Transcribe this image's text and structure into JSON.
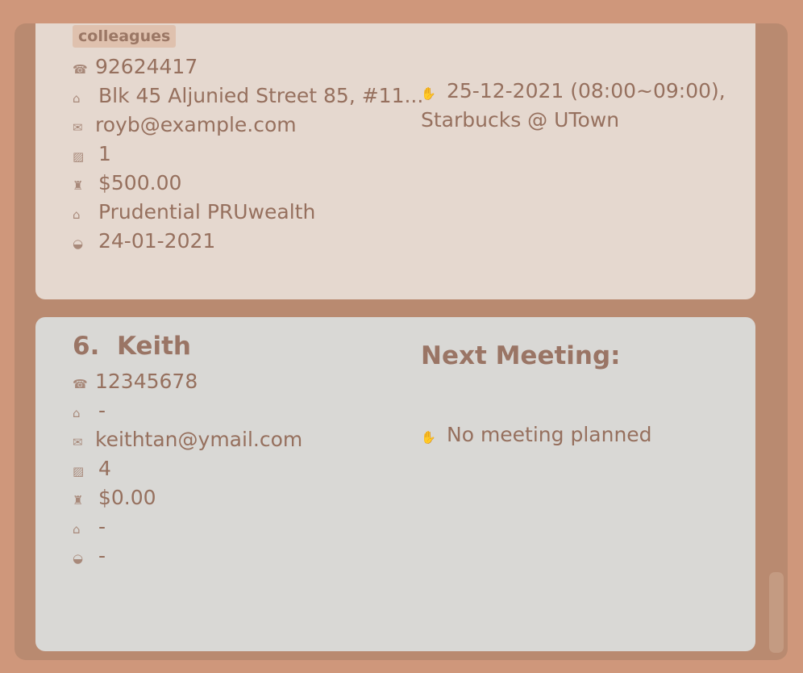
{
  "person5": {
    "tag": "colleagues",
    "phone": "92624417",
    "address": "Blk 45 Aljunied Street 85, #11...",
    "email": "royb@example.com",
    "policies": "1",
    "premium": "$500.00",
    "plan": "Prudential PRUwealth",
    "date": "24-01-2021",
    "meeting_line1": "25-12-2021 (08:00~09:00),",
    "meeting_line2": "Starbucks @ UTown"
  },
  "person6": {
    "index": "6.",
    "name": "Keith",
    "phone": "12345678",
    "address": "-",
    "email": "keithtan@ymail.com",
    "policies": "4",
    "premium": "$0.00",
    "plan": "-",
    "date": "-",
    "meeting_title": "Next Meeting:",
    "meeting": "No meeting planned"
  },
  "icons": {
    "phone": "☎",
    "address": "⌂",
    "email": "✉",
    "policies": "▨",
    "premium": "♜",
    "plan": "⌂",
    "date": "◒",
    "meeting": "✋"
  }
}
